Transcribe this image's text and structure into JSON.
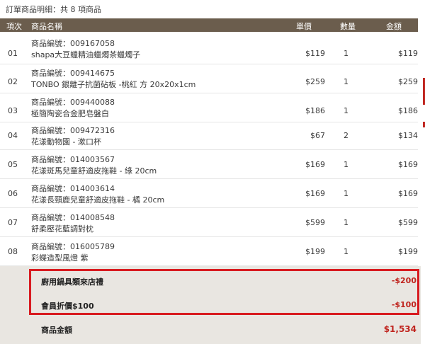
{
  "caption": "訂單商品明細：共 8 項商品",
  "columns": {
    "idx": "項次",
    "name": "商品名稱",
    "price": "單價",
    "qty": "數量",
    "amount": "金額"
  },
  "items": [
    {
      "idx": "01",
      "code_line": "商品編號：009167058",
      "name": "shapa大豆蠟精油蠟燭茶蠟燭子",
      "price": "$119",
      "qty": "1",
      "amount": "$119"
    },
    {
      "idx": "02",
      "code_line": "商品編號：009414675",
      "name": "TONBO 銀離子抗菌砧板 -桃紅 方 20x20x1cm",
      "price": "$259",
      "qty": "1",
      "amount": "$259"
    },
    {
      "idx": "03",
      "code_line": "商品編號：009440088",
      "name": "極簡陶瓷合金肥皂盤白",
      "price": "$186",
      "qty": "1",
      "amount": "$186"
    },
    {
      "idx": "04",
      "code_line": "商品編號：009472316",
      "name": "花漾動物園 - 漱口杯",
      "price": "$67",
      "qty": "2",
      "amount": "$134"
    },
    {
      "idx": "05",
      "code_line": "商品編號：014003567",
      "name": "花漾斑馬兒童舒適皮拖鞋 - 綠 20cm",
      "price": "$169",
      "qty": "1",
      "amount": "$169"
    },
    {
      "idx": "06",
      "code_line": "商品編號：014003614",
      "name": "花漾長頸鹿兒童舒適皮拖鞋 - 橘 20cm",
      "price": "$169",
      "qty": "1",
      "amount": "$169"
    },
    {
      "idx": "07",
      "code_line": "商品編號：014008548",
      "name": "舒柔壓花藍調對枕",
      "price": "$599",
      "qty": "1",
      "amount": "$599"
    },
    {
      "idx": "08",
      "code_line": "商品編號：016005789",
      "name": "彩蝶造型風燈 紫",
      "price": "$199",
      "qty": "1",
      "amount": "$199"
    }
  ],
  "discounts": [
    {
      "label": "廚用鍋具類來店禮",
      "value": "-$200"
    },
    {
      "label": "會員折價$100",
      "value": "-$100"
    }
  ],
  "total": {
    "label": "商品金額",
    "value": "$1,534"
  },
  "colors": {
    "header_bg": "#6b5d4d",
    "summary_bg": "#e9e6e1",
    "accent_red": "#c0251f",
    "highlight_border": "#d81b20"
  }
}
